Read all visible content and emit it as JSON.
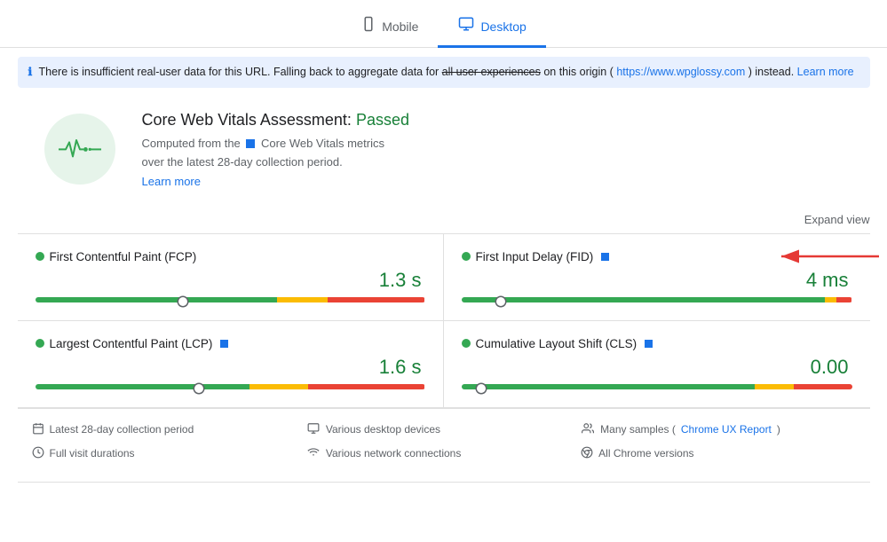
{
  "tabs": [
    {
      "id": "mobile",
      "label": "Mobile",
      "icon": "📱",
      "active": false
    },
    {
      "id": "desktop",
      "label": "Desktop",
      "icon": "🖥",
      "active": true
    }
  ],
  "banner": {
    "icon": "ℹ",
    "text_before": "There is insufficient real-user data for this URL. Falling back to aggregate data for ",
    "strikethrough": "all user experiences",
    "text_mid": " on this origin (",
    "origin_url": "https://www.wpglossy.com",
    "text_after": ") instead.",
    "learn_more_label": "Learn more",
    "learn_more_url": "#"
  },
  "cwv": {
    "title": "Core Web Vitals Assessment:",
    "status": "Passed",
    "description_before": "Computed from the",
    "description_mid": "Core Web Vitals metrics",
    "description_after": "over the latest 28-day collection period.",
    "learn_more_label": "Learn more",
    "learn_more_url": "#"
  },
  "expand_label": "Expand view",
  "metrics": [
    {
      "id": "fcp",
      "name": "First Contentful Paint (FCP)",
      "has_blue_square": false,
      "value": "1.3 s",
      "color": "green",
      "bar": {
        "green_pct": 62,
        "orange_pct": 13,
        "red_pct": 25,
        "marker_pct": 38
      }
    },
    {
      "id": "fid",
      "name": "First Input Delay (FID)",
      "has_blue_square": true,
      "value": "4 ms",
      "color": "green",
      "bar": {
        "green_pct": 93,
        "orange_pct": 3,
        "red_pct": 4,
        "marker_pct": 10
      }
    },
    {
      "id": "lcp",
      "name": "Largest Contentful Paint (LCP)",
      "has_blue_square": true,
      "value": "1.6 s",
      "color": "green",
      "bar": {
        "green_pct": 55,
        "orange_pct": 15,
        "red_pct": 30,
        "marker_pct": 42
      }
    },
    {
      "id": "cls",
      "name": "Cumulative Layout Shift (CLS)",
      "has_blue_square": true,
      "value": "0.00",
      "color": "green",
      "bar": {
        "green_pct": 75,
        "orange_pct": 10,
        "red_pct": 15,
        "marker_pct": 5
      }
    }
  ],
  "footer": {
    "items": [
      {
        "icon": "📅",
        "text": "Latest 28-day collection period",
        "link": null,
        "col": 1
      },
      {
        "icon": "🖥",
        "text": "Various desktop devices",
        "link": null,
        "col": 2
      },
      {
        "icon": "👥",
        "text": "Many samples (",
        "link_text": "Chrome UX Report",
        "link_url": "#",
        "text_after": ")",
        "col": 3
      },
      {
        "icon": "⏱",
        "text": "Full visit durations",
        "link": null,
        "col": 1
      },
      {
        "icon": "📶",
        "text": "Various network connections",
        "link": null,
        "col": 2
      },
      {
        "icon": "🌐",
        "text": "All Chrome versions",
        "link": null,
        "col": 3
      }
    ]
  }
}
